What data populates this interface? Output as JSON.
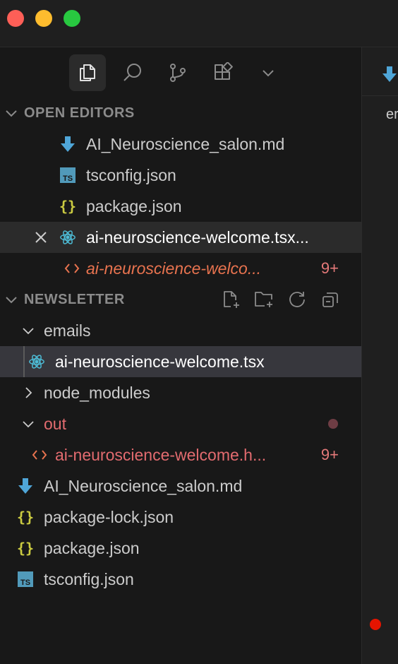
{
  "colors": {
    "folder_red": "#e26b6f",
    "modified_orange": "#e8734f",
    "json_yellow": "#cbcb41",
    "ts_blue": "#519aba",
    "react_blue": "#4dbbd5",
    "record_red": "#e51400"
  },
  "activity_bar": {
    "items": [
      {
        "icon": "files-icon",
        "active": true
      },
      {
        "icon": "search-icon",
        "active": false
      },
      {
        "icon": "source-control-icon",
        "active": false
      },
      {
        "icon": "extensions-icon",
        "active": false
      },
      {
        "icon": "chevron-down-icon",
        "active": false
      }
    ]
  },
  "open_editors": {
    "title": "OPEN EDITORS",
    "items": [
      {
        "name": "AI_Neuroscience_salon.md",
        "icon": "markdown-download-icon"
      },
      {
        "name": "tsconfig.json",
        "icon": "typescript-icon"
      },
      {
        "name": "package.json",
        "icon": "json-braces-icon"
      },
      {
        "name": "ai-neuroscience-welcome.tsx...",
        "icon": "react-icon",
        "close": "×"
      },
      {
        "name": "ai-neuroscience-welco...",
        "icon": "html-code-icon",
        "badge": "9+"
      }
    ]
  },
  "explorer": {
    "title": "NEWSLETTER",
    "header_actions": [
      "new-file-icon",
      "new-folder-icon",
      "refresh-icon",
      "collapse-all-icon"
    ],
    "items": [
      {
        "name": "emails",
        "type": "folder",
        "expanded": true
      },
      {
        "name": "ai-neuroscience-welcome.tsx",
        "icon": "react-icon"
      },
      {
        "name": "node_modules",
        "type": "folder",
        "expanded": false
      },
      {
        "name": "out",
        "type": "folder",
        "expanded": true
      },
      {
        "name": "ai-neuroscience-welcome.h...",
        "icon": "html-code-icon",
        "badge": "9+"
      },
      {
        "name": "AI_Neuroscience_salon.md",
        "icon": "markdown-download-icon"
      },
      {
        "name": "package-lock.json",
        "icon": "json-braces-icon"
      },
      {
        "name": "package.json",
        "icon": "json-braces-icon"
      },
      {
        "name": "tsconfig.json",
        "icon": "typescript-icon"
      }
    ]
  },
  "editor": {
    "tab_icon": "markdown-download-icon",
    "visible_text": "er"
  }
}
